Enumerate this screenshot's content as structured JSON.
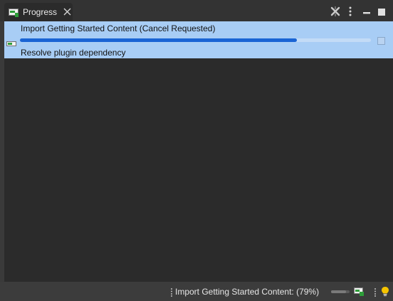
{
  "view": {
    "tab_label": "Progress",
    "tab_icon": "progress-view-icon",
    "close_icon": "close-icon",
    "toolbar": [
      {
        "name": "remove-all-finished-icon"
      },
      {
        "name": "view-menu-icon"
      },
      {
        "name": "minimize-icon"
      },
      {
        "name": "maximize-icon"
      }
    ]
  },
  "job": {
    "title": "Import Getting Started Content (Cancel Requested)",
    "subtask": "Resolve plugin dependency",
    "progress": 0.79,
    "icon": "job-icon",
    "stop_icon": "stop-icon"
  },
  "statusbar": {
    "text": "Import Getting Started Content: (79%)",
    "progress": 0.79,
    "icons": [
      "progress-view-icon",
      "tip-lightbulb-icon"
    ]
  },
  "colors": {
    "selection": "#a8cdf5",
    "progress_fill": "#1a64d4",
    "background": "#2b2b2b"
  }
}
